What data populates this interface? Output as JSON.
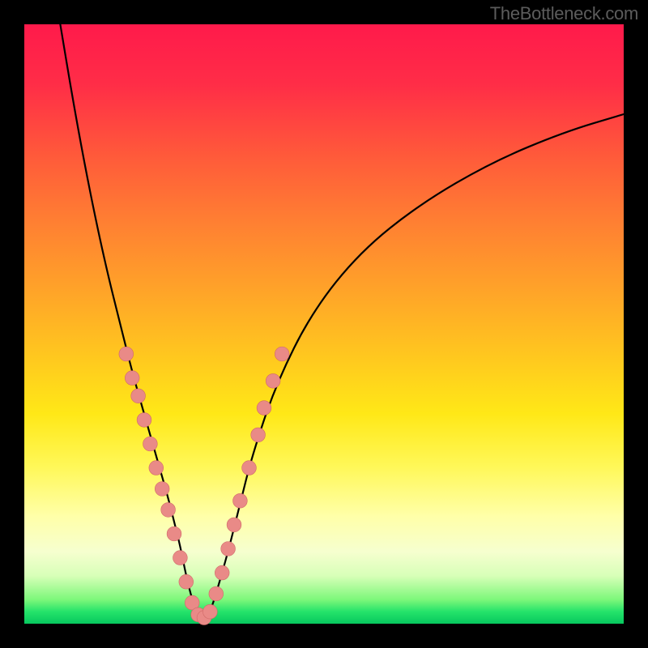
{
  "watermark": "TheBottleneck.com",
  "chart_data": {
    "type": "line",
    "title": "",
    "xlabel": "",
    "ylabel": "",
    "xlim": [
      0,
      100
    ],
    "ylim": [
      0,
      100
    ],
    "gradient_stops": [
      {
        "pos": 0,
        "color": "#ff1a4b"
      },
      {
        "pos": 22,
        "color": "#ff5a3a"
      },
      {
        "pos": 44,
        "color": "#ffa229"
      },
      {
        "pos": 65,
        "color": "#ffe817"
      },
      {
        "pos": 82,
        "color": "#ffffa8"
      },
      {
        "pos": 96,
        "color": "#7cf77a"
      },
      {
        "pos": 100,
        "color": "#07c85e"
      }
    ],
    "series": [
      {
        "name": "bottleneck-curve",
        "x": [
          6,
          8,
          10,
          12,
          14,
          16,
          18,
          20,
          22,
          24,
          25,
          26,
          27,
          28,
          29,
          30,
          31,
          32,
          34,
          36,
          38,
          42,
          48,
          56,
          66,
          78,
          90,
          100
        ],
        "y_from_top": [
          0,
          12,
          23,
          33,
          42,
          50,
          58,
          65,
          72,
          79,
          83,
          87,
          92,
          96,
          98.5,
          99,
          98,
          95,
          88,
          80,
          72,
          60,
          48,
          38,
          30,
          23,
          18,
          15
        ]
      }
    ],
    "markers": {
      "name": "sample-beads",
      "radius_pct": 1.2,
      "points": [
        {
          "x": 17.0,
          "y_from_top": 55.0
        },
        {
          "x": 18.0,
          "y_from_top": 59.0
        },
        {
          "x": 19.0,
          "y_from_top": 62.0
        },
        {
          "x": 20.0,
          "y_from_top": 66.0
        },
        {
          "x": 21.0,
          "y_from_top": 70.0
        },
        {
          "x": 22.0,
          "y_from_top": 74.0
        },
        {
          "x": 23.0,
          "y_from_top": 77.5
        },
        {
          "x": 24.0,
          "y_from_top": 81.0
        },
        {
          "x": 25.0,
          "y_from_top": 85.0
        },
        {
          "x": 26.0,
          "y_from_top": 89.0
        },
        {
          "x": 27.0,
          "y_from_top": 93.0
        },
        {
          "x": 28.0,
          "y_from_top": 96.5
        },
        {
          "x": 29.0,
          "y_from_top": 98.5
        },
        {
          "x": 30.0,
          "y_from_top": 99.0
        },
        {
          "x": 31.0,
          "y_from_top": 98.0
        },
        {
          "x": 32.0,
          "y_from_top": 95.0
        },
        {
          "x": 33.0,
          "y_from_top": 91.5
        },
        {
          "x": 34.0,
          "y_from_top": 87.5
        },
        {
          "x": 35.0,
          "y_from_top": 83.5
        },
        {
          "x": 36.0,
          "y_from_top": 79.5
        },
        {
          "x": 37.5,
          "y_from_top": 74.0
        },
        {
          "x": 39.0,
          "y_from_top": 68.5
        },
        {
          "x": 40.0,
          "y_from_top": 64.0
        },
        {
          "x": 41.5,
          "y_from_top": 59.5
        },
        {
          "x": 43.0,
          "y_from_top": 55.0
        }
      ]
    }
  }
}
